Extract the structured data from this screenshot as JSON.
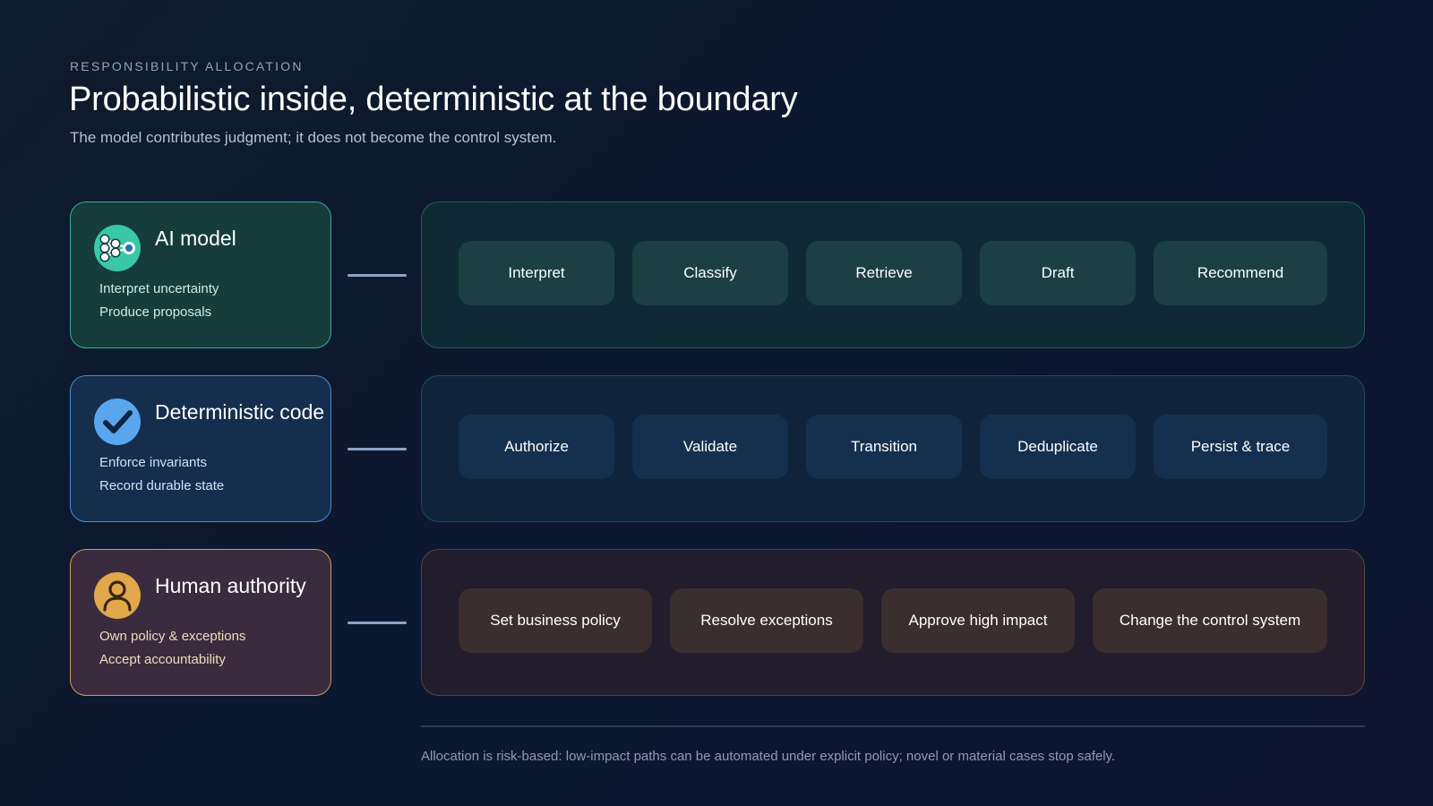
{
  "header": {
    "eyebrow": "RESPONSIBILITY ALLOCATION",
    "title": "Probabilistic inside, deterministic at the boundary",
    "subtitle": "The model contributes judgment; it does not become the control system."
  },
  "rows": [
    {
      "actor": {
        "name": "AI model",
        "icon": "neural-network-icon",
        "lines": [
          "Interpret uncertainty",
          "Produce proposals"
        ]
      },
      "capabilities": [
        "Interpret",
        "Classify",
        "Retrieve",
        "Draft",
        "Recommend"
      ],
      "colors": {
        "accent": "#39c7a7",
        "border": "#3ea99a"
      }
    },
    {
      "actor": {
        "name": "Deterministic code",
        "icon": "checkmark-icon",
        "lines": [
          "Enforce invariants",
          "Record durable state"
        ]
      },
      "capabilities": [
        "Authorize",
        "Validate",
        "Transition",
        "Deduplicate",
        "Persist & trace"
      ],
      "colors": {
        "accent": "#5aa6ee",
        "border": "#4a8ad0"
      }
    },
    {
      "actor": {
        "name": "Human authority",
        "icon": "person-icon",
        "lines": [
          "Own policy & exceptions",
          "Accept accountability"
        ]
      },
      "capabilities": [
        "Set business policy",
        "Resolve exceptions",
        "Approve high impact",
        "Change the control system"
      ],
      "colors": {
        "accent": "#e0a84a",
        "border": "#c99a5a"
      }
    }
  ],
  "footer": {
    "note": "Allocation is risk-based: low-impact paths can be automated under explicit policy; novel or material cases stop safely."
  }
}
